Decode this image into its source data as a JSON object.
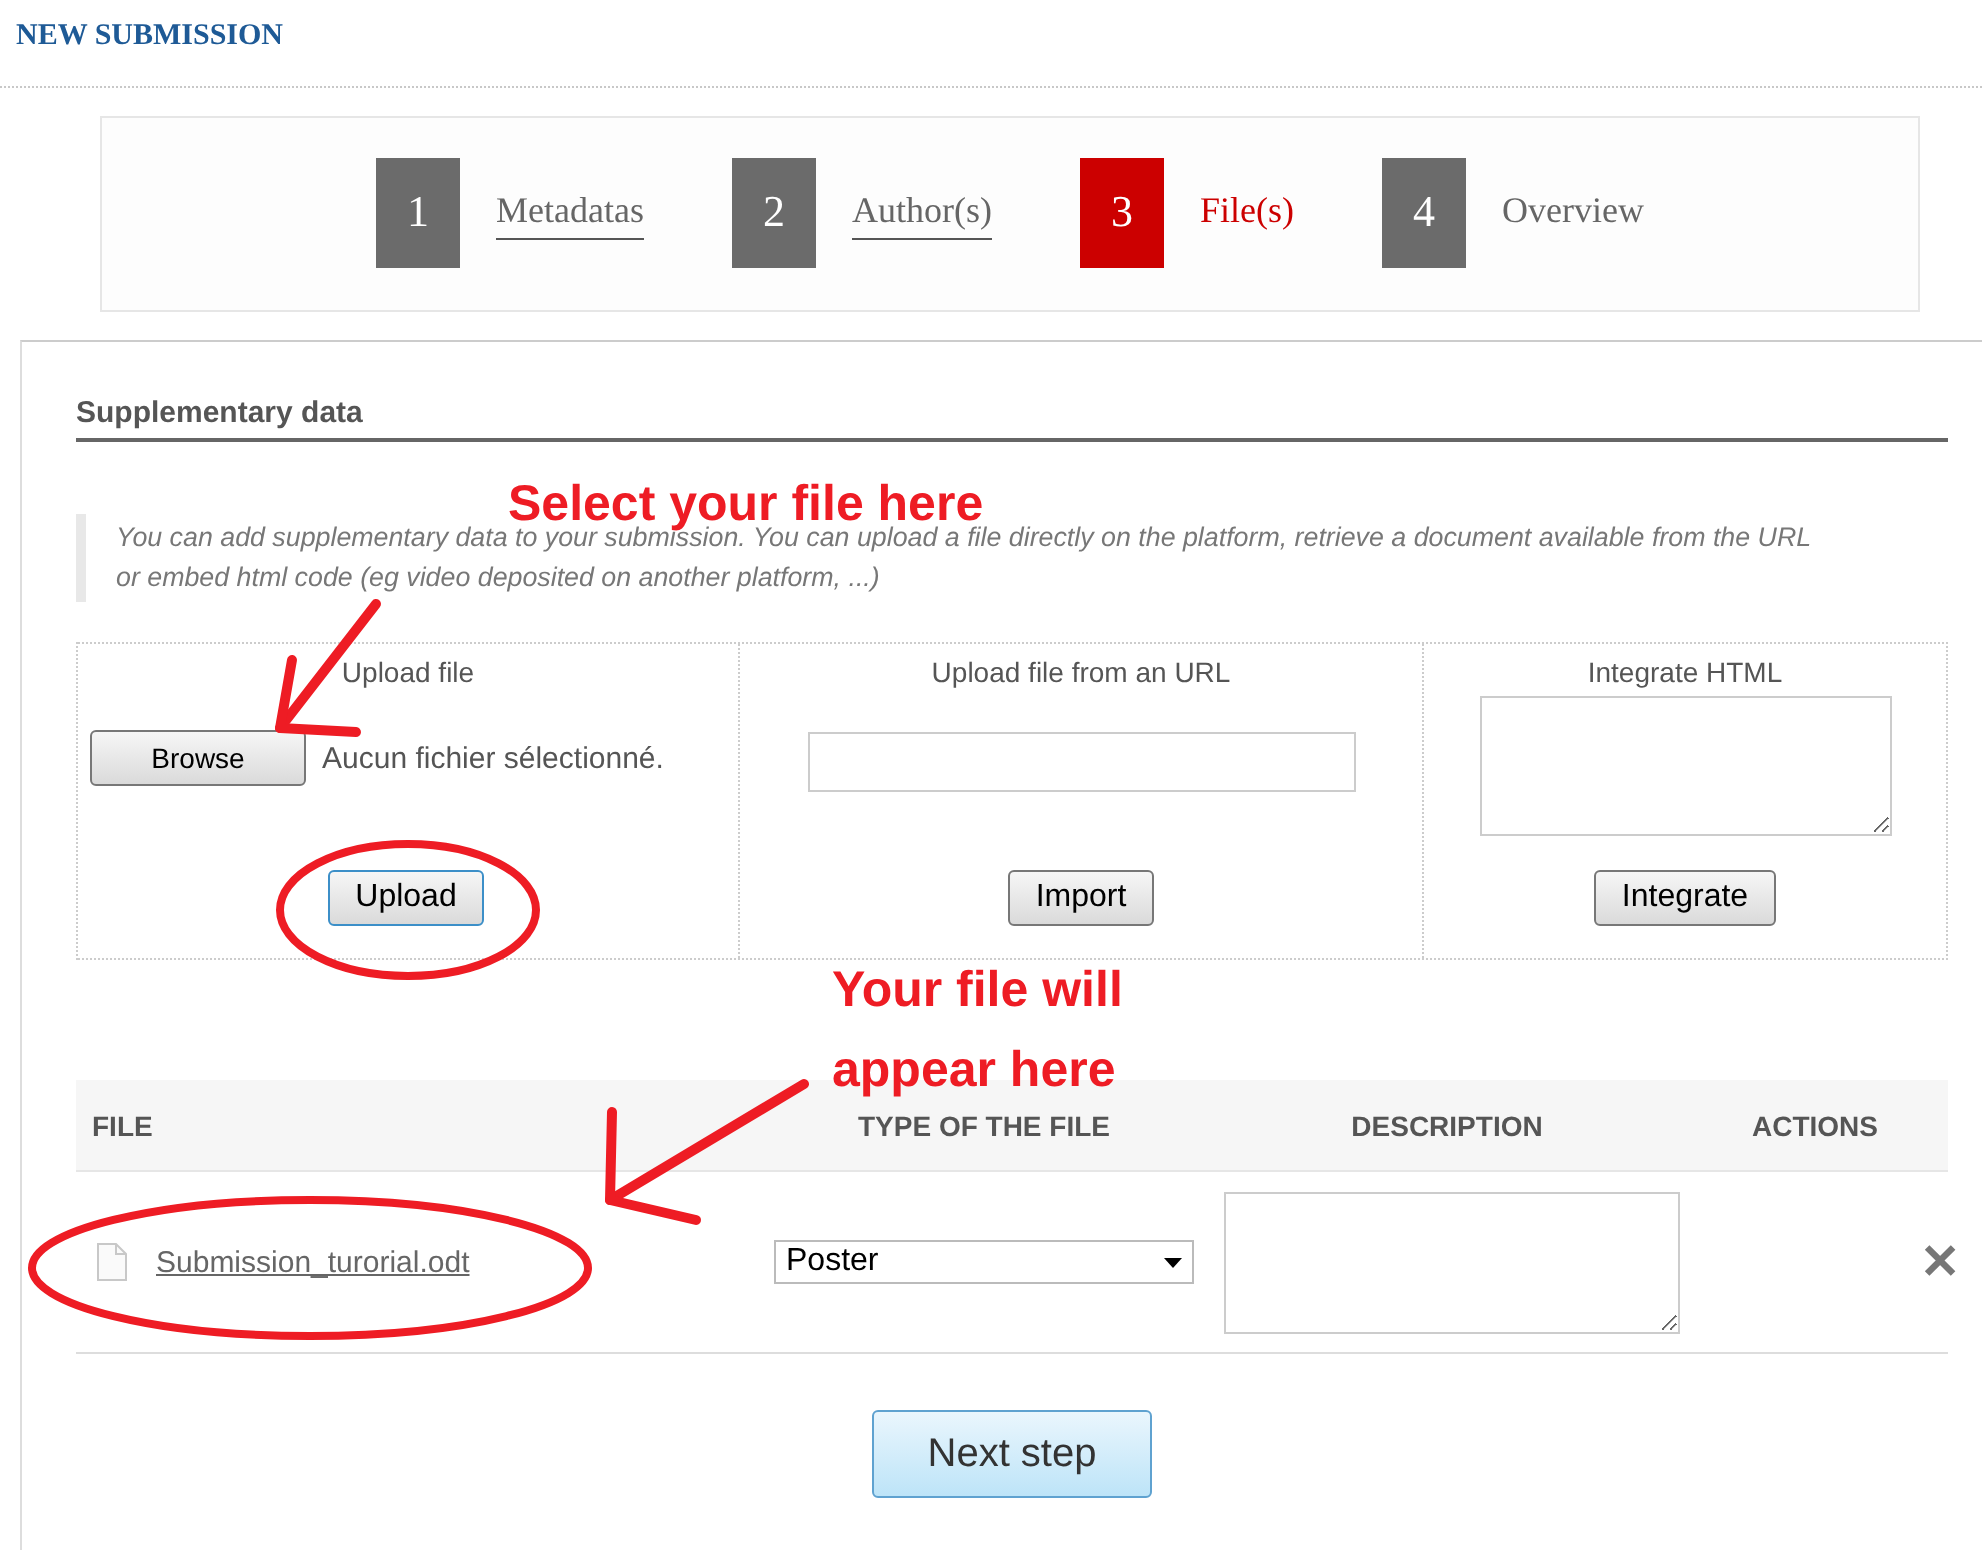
{
  "page_title": "NEW SUBMISSION",
  "steps": [
    {
      "number": "1",
      "label": "Metadatas",
      "selected": false,
      "completed": true
    },
    {
      "number": "2",
      "label": "Author(s)",
      "selected": false,
      "completed": true
    },
    {
      "number": "3",
      "label": "File(s)",
      "selected": true,
      "completed": false
    },
    {
      "number": "4",
      "label": "Overview",
      "selected": false,
      "completed": false
    }
  ],
  "section_title": "Supplementary data",
  "note": "You can add supplementary data to your submission. You can upload a file directly on the platform, retrieve a document available from the URL or embed html code (eg video deposited on another platform, ...)",
  "upload_panels": [
    {
      "kind": "file",
      "title": "Upload file",
      "browse_label": "Browse",
      "file_status": "Aucun fichier sélectionné.",
      "button": "Upload"
    },
    {
      "kind": "url",
      "title": "Upload file from an URL",
      "button": "Import"
    },
    {
      "kind": "html",
      "title": "Integrate HTML",
      "button": "Integrate"
    }
  ],
  "table": {
    "columns": [
      "FILE",
      "TYPE OF THE FILE",
      "DESCRIPTION",
      "ACTIONS"
    ],
    "rows": [
      {
        "file": "Submission_turorial.odt",
        "type": "Poster",
        "delete": "✕"
      }
    ]
  },
  "next_button": "Next step",
  "annotations": [
    {
      "text": "Select your file here"
    },
    {
      "text": "Your file will appear here"
    }
  ]
}
